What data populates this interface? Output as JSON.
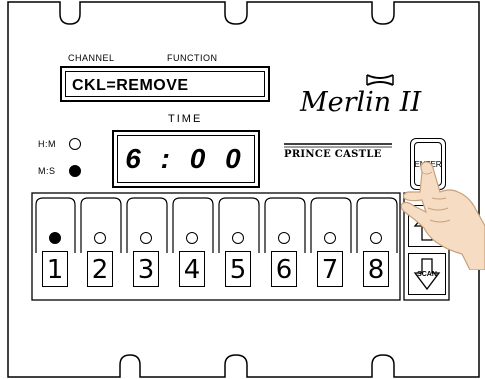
{
  "display": {
    "channel_label": "CHANNEL",
    "function_label": "FUNCTION",
    "channel_value": "CKL=REMOVE",
    "time_label": "TIME",
    "time_value": "6 : 0 0"
  },
  "mode": {
    "hm_label": "H:M",
    "ms_label": "M:S",
    "selected": "M:S"
  },
  "brand": {
    "logo_text": "Merlin II",
    "maker": "PRINCE CASTLE"
  },
  "buttons": {
    "enter_label": "ENTER",
    "scan_label": "SCAN"
  },
  "channels": [
    {
      "label": "1",
      "led_on": true
    },
    {
      "label": "2",
      "led_on": false
    },
    {
      "label": "3",
      "led_on": false
    },
    {
      "label": "4",
      "led_on": false
    },
    {
      "label": "5",
      "led_on": false
    },
    {
      "label": "6",
      "led_on": false
    },
    {
      "label": "7",
      "led_on": false
    },
    {
      "label": "8",
      "led_on": false
    }
  ],
  "colors": {
    "outline": "#000000",
    "panel": "#ffffff",
    "hand_skin": "#f6dcc2",
    "hand_outline": "#c8a07a"
  }
}
